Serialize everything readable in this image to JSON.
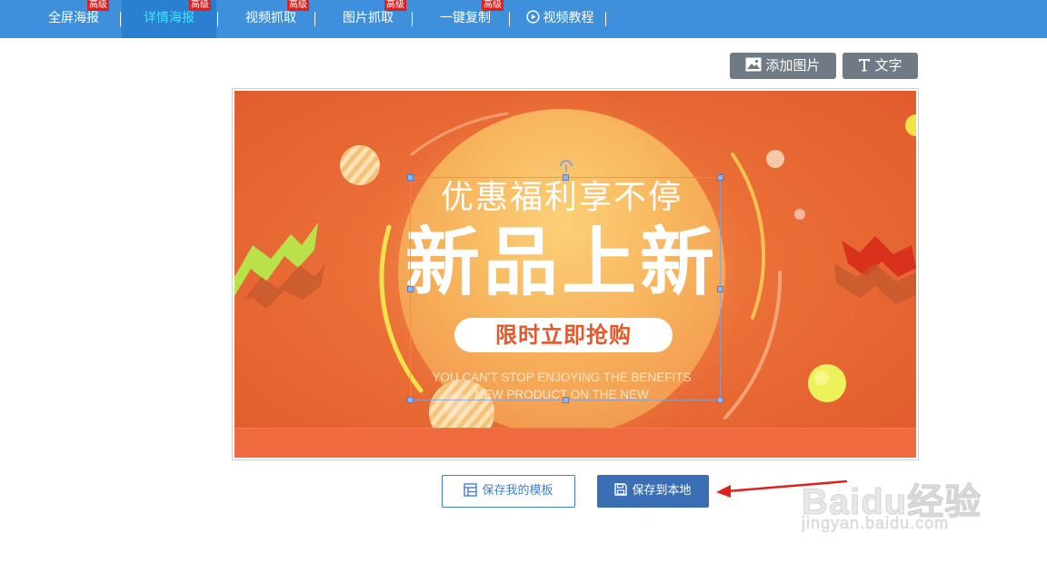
{
  "nav": {
    "items": [
      {
        "label": "全屏海报",
        "badge": "高级"
      },
      {
        "label": "详情海报",
        "badge": "高级"
      },
      {
        "label": "视频抓取",
        "badge": "高级"
      },
      {
        "label": "图片抓取",
        "badge": "高级"
      },
      {
        "label": "一键复制",
        "badge": "高级"
      },
      {
        "label": "视频教程",
        "badge": ""
      }
    ],
    "active_index": 1
  },
  "toolbar": {
    "add_image_label": "添加图片",
    "text_label": "文字"
  },
  "poster": {
    "line1": "优惠福利享不停",
    "line2": "新品上新",
    "pill": "限时立即抢购",
    "en_line1": "YOU CAN'T STOP ENJOYING THE BENEFITS",
    "en_line2": "NEW PRODUCT ON THE NEW"
  },
  "actions": {
    "save_template_label": "保存我的模板",
    "save_local_label": "保存到本地"
  },
  "watermark": {
    "main": "Baidu经验",
    "sub": "jingyan.baidu.com"
  },
  "colors": {
    "nav_bg": "#3e8fdc",
    "nav_active_text": "#3ee6ff",
    "badge": "#e02020",
    "tool_btn": "#6f7a85",
    "primary": "#3a6fb6",
    "arrow": "#e0201f"
  }
}
